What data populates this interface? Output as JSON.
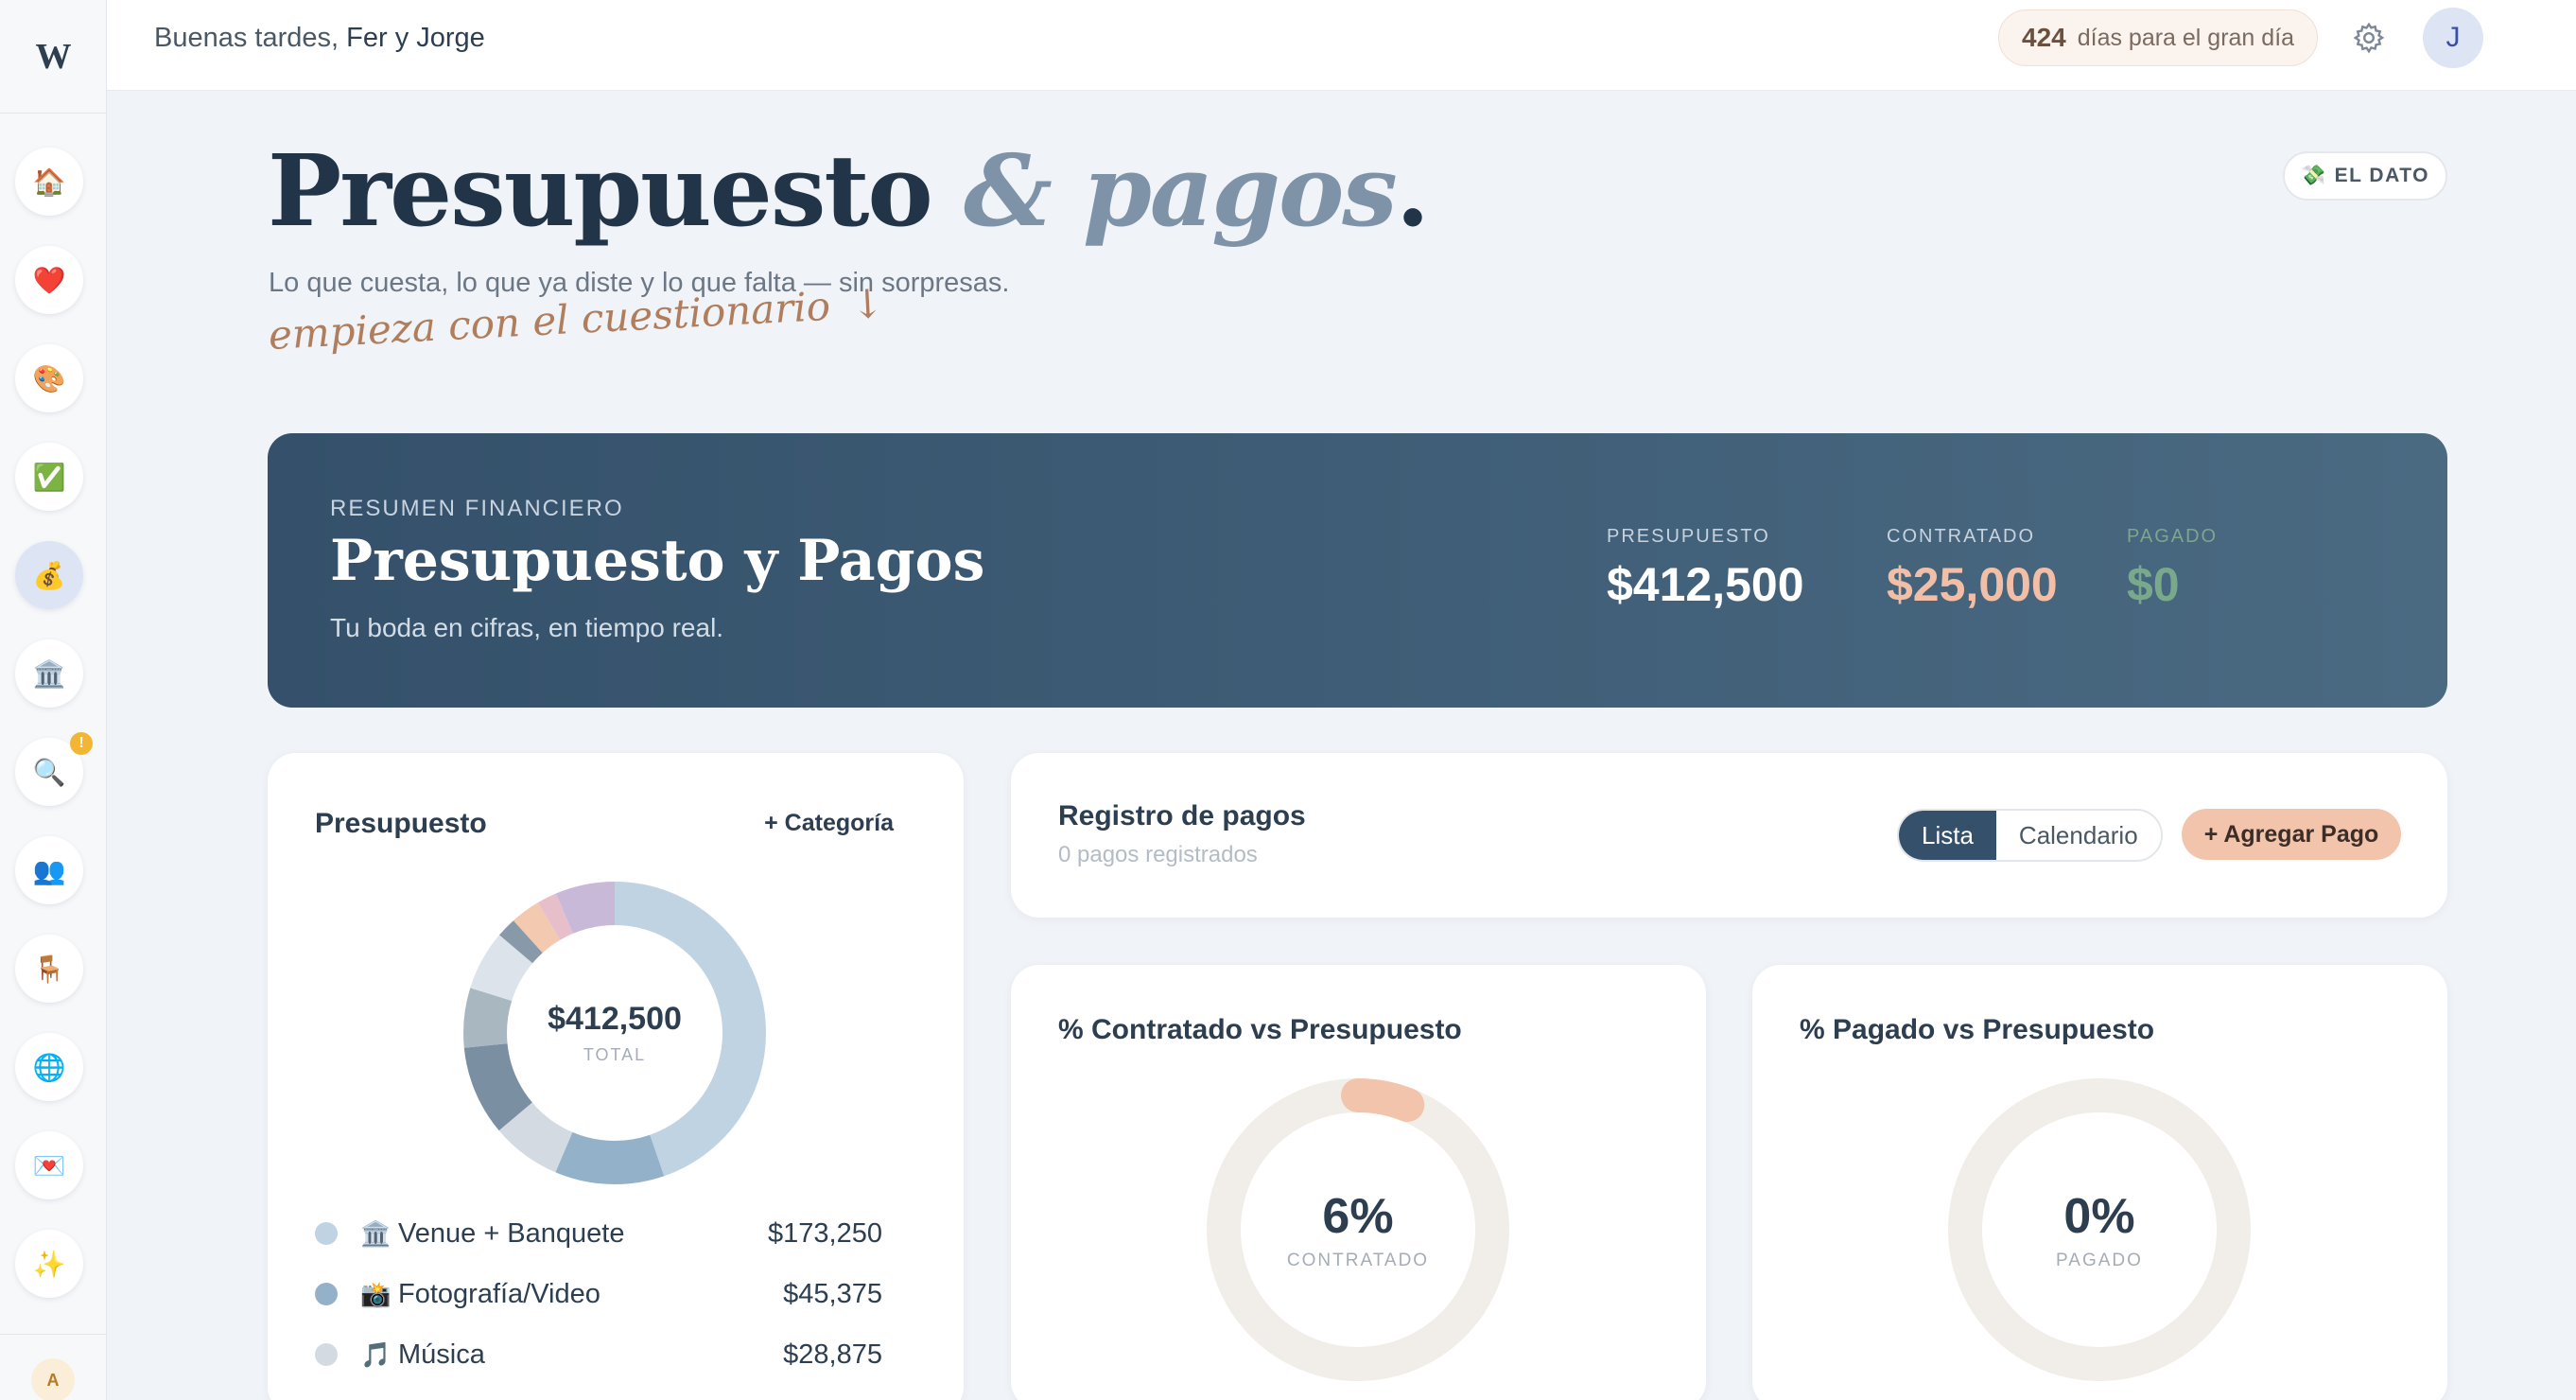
{
  "app": {
    "logo_text": "W"
  },
  "sidebar": {
    "items": [
      {
        "name": "home",
        "icon": "🏠"
      },
      {
        "name": "love",
        "icon": "❤️"
      },
      {
        "name": "design",
        "icon": "🎨"
      },
      {
        "name": "tasks",
        "icon": "✅"
      },
      {
        "name": "budget",
        "icon": "💰",
        "active": true
      },
      {
        "name": "venue",
        "icon": "🏛️"
      },
      {
        "name": "search",
        "icon": "🔍",
        "badge": "!"
      },
      {
        "name": "guests",
        "icon": "👥"
      },
      {
        "name": "seating",
        "icon": "🪑"
      },
      {
        "name": "website",
        "icon": "🌐"
      },
      {
        "name": "invitations",
        "icon": "💌"
      },
      {
        "name": "extras",
        "icon": "✨"
      }
    ],
    "user_initial": "A"
  },
  "topbar": {
    "greeting_prefix": "Buenas tardes,",
    "greeting_names": "Fer y Jorge",
    "days_count": "424",
    "days_label": "días para el gran día",
    "avatar_initial": "J"
  },
  "header": {
    "title_main": "Presupuesto",
    "title_accent": "& pagos",
    "title_dot": ".",
    "subtitle": "Lo que cuesta, lo que ya diste y lo que falta — sin sorpresas.",
    "cta_text": "empieza con el cuestionario",
    "cta_arrow": "↓",
    "tip_icon": "💸",
    "tip_label": "EL DATO"
  },
  "summary": {
    "eyebrow": "RESUMEN FINANCIERO",
    "title": "Presupuesto y Pagos",
    "subtitle": "Tu boda en cifras, en tiempo real.",
    "stats": {
      "budget": {
        "label": "PRESUPUESTO",
        "value": "$412,500"
      },
      "contracted": {
        "label": "CONTRATADO",
        "value": "$25,000"
      },
      "paid": {
        "label": "PAGADO",
        "value": "$0"
      }
    }
  },
  "budget_card": {
    "title": "Presupuesto",
    "add_category_label": "+ Categoría",
    "total_value": "$412,500",
    "total_label": "TOTAL",
    "legend": [
      {
        "emoji": "🏛️",
        "name": "Venue + Banquete",
        "amount": "$173,250"
      },
      {
        "emoji": "📸",
        "name": "Fotografía/Video",
        "amount": "$45,375"
      },
      {
        "emoji": "🎵",
        "name": "Música",
        "amount": "$28,875"
      }
    ]
  },
  "payments_card": {
    "title": "Registro de pagos",
    "count_text": "0 pagos registrados",
    "view_list": "Lista",
    "view_calendar": "Calendario",
    "add_payment_label": "+ Agregar Pago"
  },
  "contracted_card": {
    "title": "% Contratado vs Presupuesto",
    "percent_text": "6%",
    "label": "CONTRATADO",
    "fraction": 0.06,
    "color": "#f2c4ac"
  },
  "paid_card": {
    "title": "% Pagado vs Presupuesto",
    "percent_text": "0%",
    "label": "PAGADO",
    "fraction": 0,
    "color": "#79a98a"
  },
  "chart_data": {
    "type": "pie",
    "title": "Presupuesto",
    "total": 412500,
    "slices": [
      {
        "name": "Venue + Banquete",
        "value": 173250,
        "color": "#bfd3e2"
      },
      {
        "name": "Fotografía/Video",
        "value": 45375,
        "color": "#93b2ca"
      },
      {
        "name": "Música",
        "value": 28875,
        "color": "#d4dae1"
      },
      {
        "value": 37125,
        "color": "#7b8fa2"
      },
      {
        "value": 24750,
        "color": "#a9b7c0"
      },
      {
        "value": 24750,
        "color": "#dde3ea"
      },
      {
        "value": 8250,
        "color": "#8899a9"
      },
      {
        "value": 12375,
        "color": "#f3c9b0"
      },
      {
        "value": 8250,
        "color": "#e6bfca"
      },
      {
        "value": 24750,
        "color": "#c9b9d8"
      }
    ]
  },
  "colors": {
    "brand_dark": "#34506a",
    "accent_peach": "#f2c4ac",
    "paid_green": "#79a98a",
    "ring_track": "#f1ede8"
  }
}
